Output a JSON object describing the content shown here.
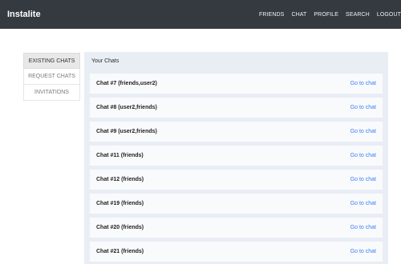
{
  "navbar": {
    "brand": "Instalite",
    "links": [
      "FRIENDS",
      "CHAT",
      "PROFILE",
      "SEARCH",
      "LOGOUT"
    ]
  },
  "sidebar": {
    "items": [
      {
        "label": "EXISTING CHATS",
        "active": true
      },
      {
        "label": "REQUEST CHATS",
        "active": false
      },
      {
        "label": "INVITATIONS",
        "active": false
      }
    ]
  },
  "main": {
    "title": "Your Chats",
    "chats": [
      {
        "name": "Chat #7 (friends,user2)",
        "link": "Go to chat"
      },
      {
        "name": "Chat #8 (user2,friends)",
        "link": "Go to chat"
      },
      {
        "name": "Chat #9 (user2,friends)",
        "link": "Go to chat"
      },
      {
        "name": "Chat #11 (friends)",
        "link": "Go to chat"
      },
      {
        "name": "Chat #12 (friends)",
        "link": "Go to chat"
      },
      {
        "name": "Chat #19 (friends)",
        "link": "Go to chat"
      },
      {
        "name": "Chat #20 (friends)",
        "link": "Go to chat"
      },
      {
        "name": "Chat #21 (friends)",
        "link": "Go to chat"
      }
    ]
  },
  "colors": {
    "navbar_bg": "#343a40",
    "link_blue": "#3b82f6",
    "panel_bg": "#e9eef5"
  }
}
